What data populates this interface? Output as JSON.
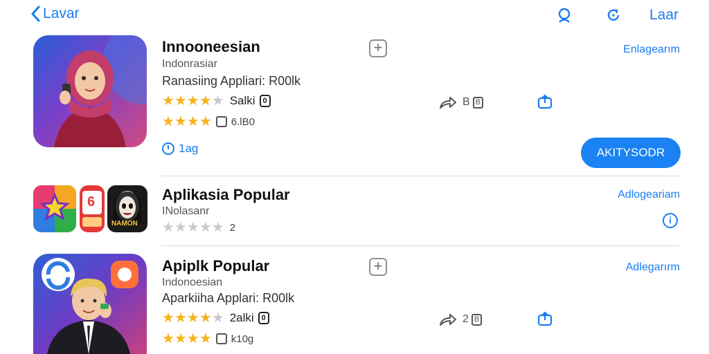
{
  "topbar": {
    "back_label": "Lavar",
    "right_label": "Laar"
  },
  "apps": [
    {
      "title": "Innooneesian",
      "subtitle": "Indonrasiar",
      "description": "Ranasiing Appliari: R00lk",
      "stars_text": "Salki",
      "stars_badge": "0",
      "meta_text": "6.lB0",
      "share_text": "B",
      "share_box": "B",
      "right_link": "Enlagearım",
      "link_text": "1ag",
      "install_label": "AKITYSODR"
    },
    {
      "title": "Aplikasia Popular",
      "subtitle": "INolasanr",
      "meta_text": "2",
      "right_link": "Adlogeariam",
      "info_label": "i",
      "thumb_label_2": "6",
      "thumb_label_3": "NAMON"
    },
    {
      "title": "Apiplk Popular",
      "subtitle": "Indonoesian",
      "description": "Aparkiiha Applari: R00lk",
      "stars_text": "2alki",
      "stars_badge": "0",
      "meta_text": "k10g",
      "share_text": "2",
      "share_box": "B",
      "right_link": "Adlegarırm"
    }
  ],
  "colors": {
    "accent": "#1a7cf0",
    "star": "#f6b21a",
    "install_bg": "#1a82f2"
  }
}
